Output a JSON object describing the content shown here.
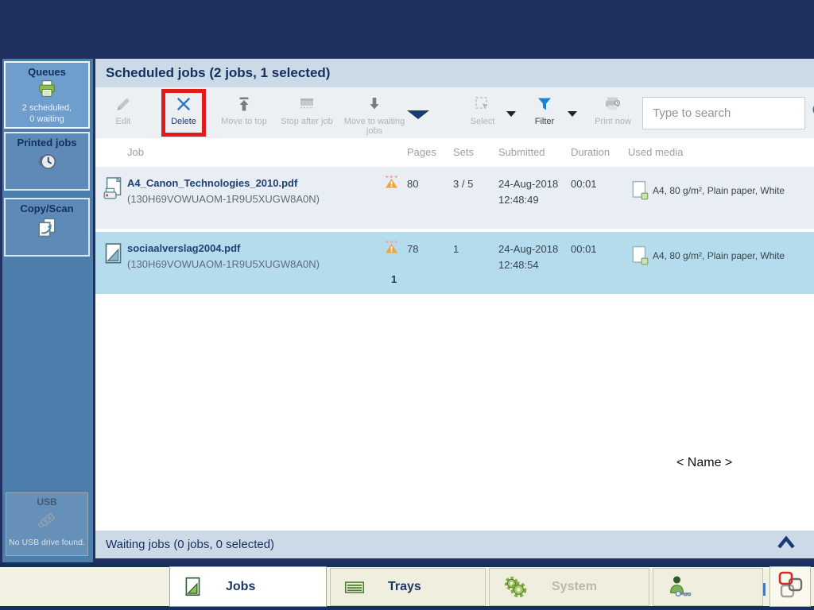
{
  "sidebar": {
    "queues": {
      "label": "Queues",
      "status_line1": "2 scheduled,",
      "status_line2": "0 waiting"
    },
    "printed_jobs": {
      "label": "Printed jobs"
    },
    "copy_scan": {
      "label": "Copy/Scan"
    },
    "usb": {
      "label": "USB",
      "status": "No USB drive found."
    }
  },
  "header": {
    "title": "Scheduled jobs (2 jobs, 1 selected)"
  },
  "toolbar": {
    "edit_label": "Edit",
    "delete_label": "Delete",
    "move_to_top_label": "Move to top",
    "stop_after_job_label": "Stop after job",
    "move_to_waiting_label": "Move to waiting jobs",
    "select_label": "Select",
    "filter_label": "Filter",
    "print_now_label": "Print now",
    "search_placeholder": "Type to search"
  },
  "table": {
    "col_job": "Job",
    "col_pages": "Pages",
    "col_sets": "Sets",
    "col_submitted": "Submitted",
    "col_duration": "Duration",
    "col_used_media": "Used media"
  },
  "jobs": [
    {
      "name": "A4_Canon_Technologies_2010.pdf",
      "id": "(130H69VOWUAOM-1R9U5XUGW8A0N)",
      "pages": "80",
      "sets": "3 / 5",
      "submitted_date": "24-Aug-2018",
      "submitted_time": "12:48:49",
      "duration": "00:01",
      "media": "A4, 80 g/m², Plain paper, White",
      "progress": ""
    },
    {
      "name": "sociaalverslag2004.pdf",
      "id": "(130H69VOWUAOM-1R9U5XUGW8A0N)",
      "pages": "78",
      "sets": "1",
      "submitted_date": "24-Aug-2018",
      "submitted_time": "12:48:54",
      "duration": "00:01",
      "media": "A4, 80 g/m², Plain paper, White",
      "progress": "1"
    }
  ],
  "name_placeholder": "< Name >",
  "waiting_bar": {
    "title": "Waiting jobs (0 jobs, 0 selected)"
  },
  "tabs": {
    "jobs": "Jobs",
    "trays": "Trays",
    "system": "System"
  },
  "colors": {
    "accent_blue": "#2e75c4",
    "filter_blue": "#1e83d3",
    "navy": "#14305f",
    "warning_orange": "#f2a33c",
    "highlight_red": "#e01b1b",
    "selected_row": "#b4dcec",
    "row_alt": "#e9eef4",
    "sidebar_blue": "#4d7dab",
    "bottom_cream": "#f2f1e3"
  }
}
